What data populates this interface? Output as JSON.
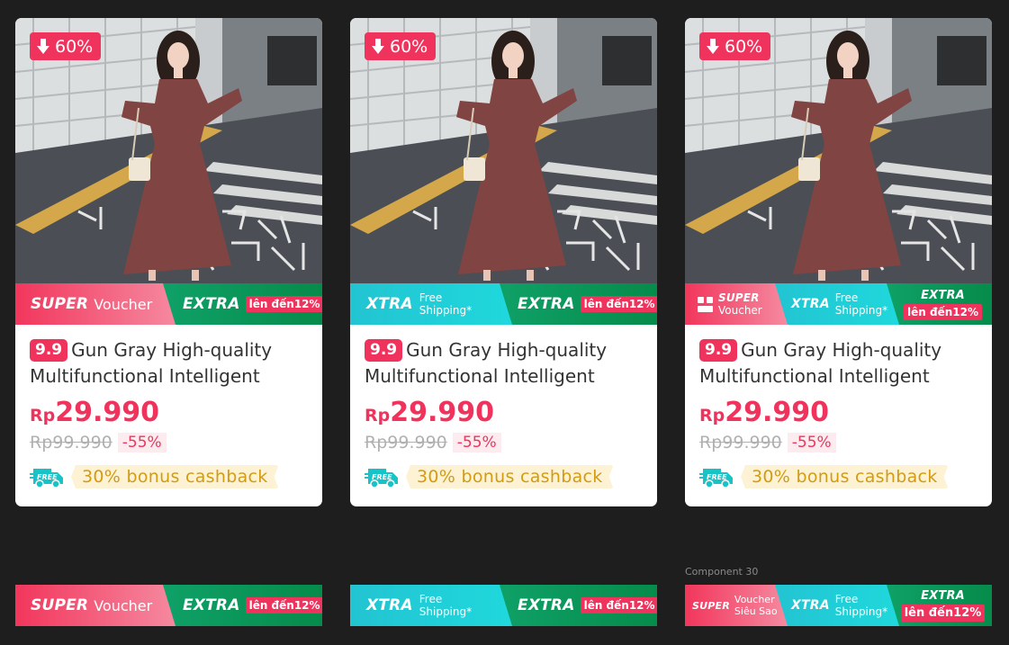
{
  "cards": [
    {
      "discount_badge": "60%",
      "strip": {
        "super": "SUPER",
        "voucher": "Voucher",
        "extra": "EXTRA",
        "upto": "lên đến12%"
      },
      "tag": "9.9",
      "title": "Gun Gray High-quality Multifunctional Intelligent",
      "price_currency": "Rp",
      "price": "29.990",
      "old_price": "Rp99.990",
      "discount": "-55%",
      "free_label": "FREE",
      "cashback": "30% bonus cashback"
    },
    {
      "discount_badge": "60%",
      "strip": {
        "xtra": "XTRA",
        "free1": "Free",
        "free2": "Shipping*",
        "extra": "EXTRA",
        "upto": "lên đến12%"
      },
      "tag": "9.9",
      "title": "Gun Gray High-quality Multifunctional Intelligent",
      "price_currency": "Rp",
      "price": "29.990",
      "old_price": "Rp99.990",
      "discount": "-55%",
      "free_label": "FREE",
      "cashback": "30% bonus cashback"
    },
    {
      "discount_badge": "60%",
      "strip": {
        "super": "SUPER",
        "voucher": "Voucher",
        "xtra": "XTRA",
        "free1": "Free",
        "free2": "Shipping*",
        "extra": "EXTRA",
        "upto": "lên đến12%"
      },
      "tag": "9.9",
      "title": "Gun Gray High-quality Multifunctional Intelligent",
      "price_currency": "Rp",
      "price": "29.990",
      "old_price": "Rp99.990",
      "discount": "-55%",
      "free_label": "FREE",
      "cashback": "30% bonus cashback"
    }
  ],
  "bottom_strips": [
    {
      "super": "SUPER",
      "voucher": "Voucher",
      "extra": "EXTRA",
      "upto": "lên đến12%"
    },
    {
      "xtra": "XTRA",
      "free1": "Free",
      "free2": "Shipping*",
      "extra": "EXTRA",
      "upto": "lên đến12%"
    },
    {
      "super": "SUPER",
      "voucher1": "Voucher",
      "voucher2": "Siêu Sao",
      "xtra": "XTRA",
      "free1": "Free",
      "free2": "Shipping*",
      "extra": "EXTRA",
      "upto": "lên đến12%"
    }
  ],
  "component_label": "Component 30",
  "colors": {
    "brand_pink": "#f0335c",
    "xtra_cyan": "#1fd0d8",
    "extra_green": "#0a9a5a",
    "cashback_gold": "#d39b12",
    "free_teal": "#18c3c8"
  }
}
